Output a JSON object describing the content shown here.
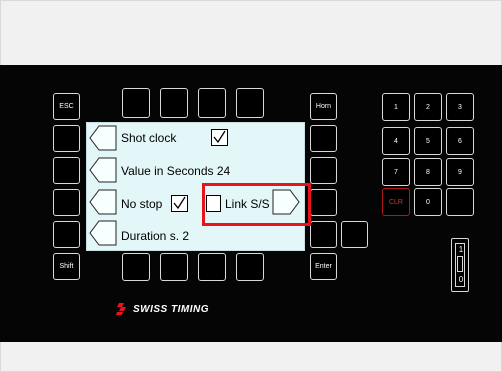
{
  "keys": {
    "esc": "ESC",
    "shift": "Shift",
    "horn": "Horn",
    "enter": "Enter",
    "clr": "CLR",
    "digits": [
      "1",
      "2",
      "3",
      "4",
      "5",
      "6",
      "7",
      "8",
      "9",
      "0"
    ]
  },
  "screen": {
    "line1": "Shot clock",
    "line2": "Value in Seconds 24",
    "line3_left": "No stop",
    "line3_right": "Link S/S",
    "line4": "Duration s. 2",
    "shot_clock_checked": true,
    "no_stop_checked": true,
    "link_ss_checked": false
  },
  "toggle": {
    "top_label": "1",
    "bottom_label": "0"
  },
  "logo": {
    "text": "SWISS TIMING",
    "icon": "swiss-timing-logo-icon"
  },
  "colors": {
    "panel": "#050505",
    "screen": "#e3f7f9",
    "highlight": "#e8141c",
    "clr": "#e03030"
  }
}
